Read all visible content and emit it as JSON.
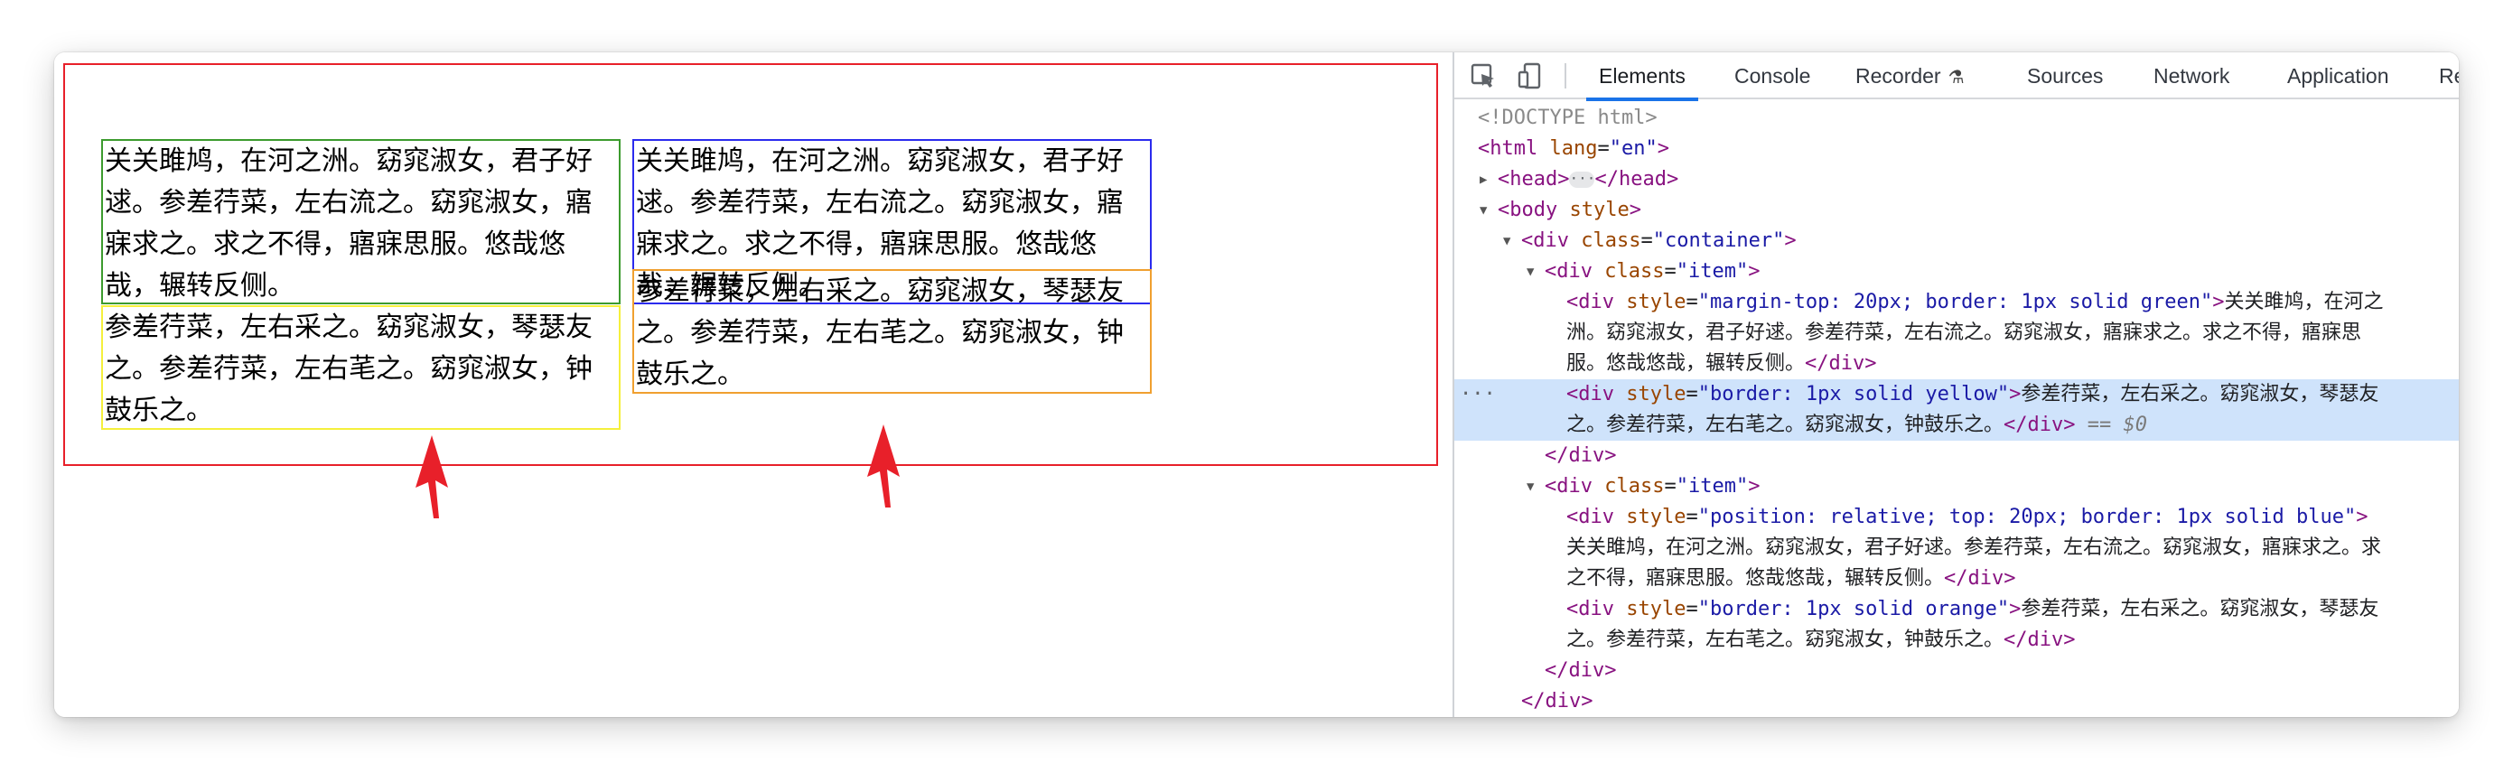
{
  "preview": {
    "green_text": "关关雎鸠，在河之洲。窈窕淑女，君子好逑。参差荇菜，左右流之。窈窕淑女，寤寐求之。求之不得，寤寐思服。悠哉悠哉，辗转反侧。",
    "yellow_text": "参差荇菜，左右采之。窈窕淑女，琴瑟友之。参差荇菜，左右芼之。窈窕淑女，钟鼓乐之。",
    "blue_text": "关关雎鸠，在河之洲。窈窕淑女，君子好逑。参差荇菜，左右流之。窈窕淑女，寤寐求之。求之不得，寤寐思服。悠哉悠哉，辗转反侧。",
    "orange_text": "参差荇菜，左右采之。窈窕淑女，琴瑟友之。参差荇菜，左右芼之。窈窕淑女，钟鼓乐之。"
  },
  "devtools": {
    "tabs": [
      "Elements",
      "Console",
      "Recorder",
      "Sources",
      "Network",
      "Application",
      "Rec"
    ],
    "active_tab": "Elements",
    "tree": {
      "doctype": "<!DOCTYPE html>",
      "html_open": "<html",
      "html_lang_attr": "lang",
      "html_lang_val": "\"en\"",
      "html_close": ">",
      "head_open": "<head>",
      "head_close": "</head>",
      "ellipsis": "···",
      "body_open": "<body",
      "body_style_attr": "style",
      "body_close": ">",
      "container_open": "<div",
      "class_attr": "class",
      "container_class_val": "\"container\"",
      "item_class_val": "\"item\"",
      "gt": ">",
      "div_open": "<div",
      "style_attr": "style",
      "green_style_val": "\"margin-top: 20px; border: 1px solid green\"",
      "green_text_l1": "关关雎鸠，在河之",
      "green_text_l2": "洲。窈窕淑女，君子好逑。参差荇菜，左右流之。窈窕淑女，寤寐求之。求之不得，寤寐思",
      "green_text_l3": "服。悠哉悠哉，辗转反侧。",
      "div_close": "</div>",
      "yellow_style_val": "\"border: 1px solid yellow\"",
      "yellow_text_l1": "参差荇菜，左右采之。窈窕淑女，琴瑟友",
      "yellow_text_l2": "之。参差荇菜，左右芼之。窈窕淑女，钟鼓乐之。",
      "selected_marker": "== $0",
      "row_dots": "···",
      "blue_style_val": "\"position: relative; top: 20px; border: 1px solid blue\"",
      "blue_text_l1": "关关雎鸠，在河之洲。窈窕淑女，君子好逑。参差荇菜，左右流之。窈窕淑女，寤寐求之。求",
      "blue_text_l2": "之不得，寤寐思服。悠哉悠哉，辗转反侧。",
      "orange_style_val": "\"border: 1px solid orange\"",
      "orange_text_l1": "参差荇菜，左右采之。窈窕淑女，琴瑟友",
      "orange_text_l2": "之。参差荇菜，左右芼之。窈窕淑女，钟鼓乐之。"
    }
  },
  "colors": {
    "container_border": "#e8202a",
    "green": "#3c9b2e",
    "yellow": "#f5f03c",
    "blue": "#2b2bee",
    "orange": "#f0a030",
    "selection": "#cfe3fb",
    "tab_underline": "#1a73e8",
    "arrow": "#e8202a"
  },
  "icons": [
    "inspect-cursor-icon",
    "device-toolbar-icon",
    "beaker-icon",
    "expand-triangle-icon",
    "collapse-triangle-icon",
    "ellipsis-icon",
    "red-arrow-icon"
  ]
}
